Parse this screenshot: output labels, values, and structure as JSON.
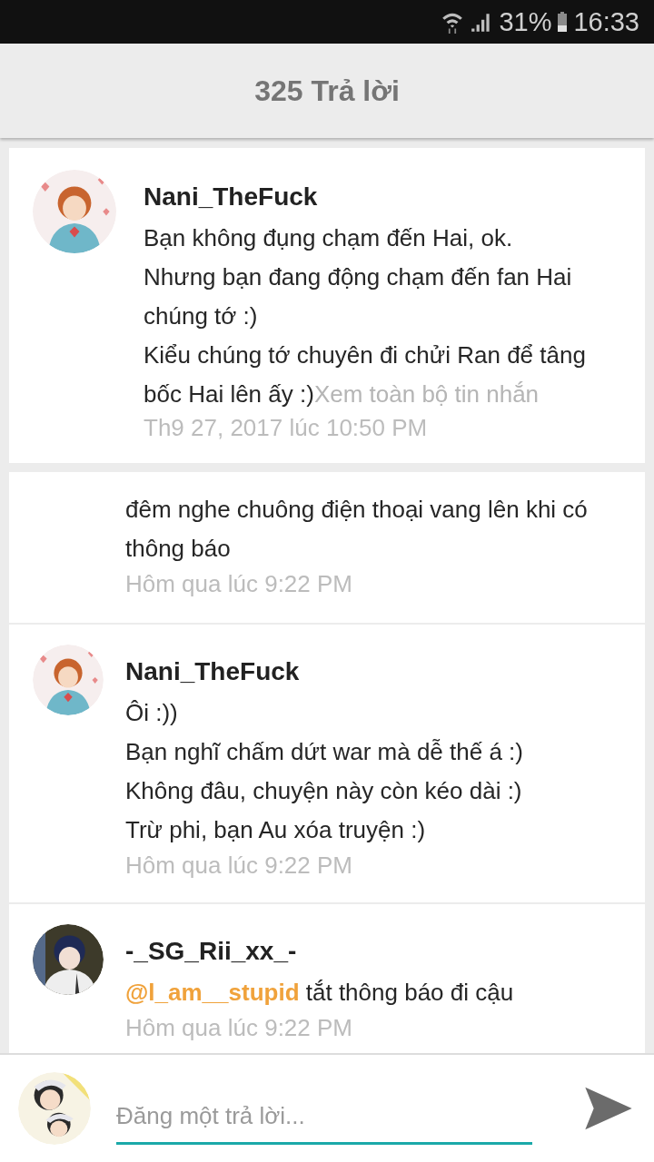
{
  "status_bar": {
    "battery": "31%",
    "time": "16:33"
  },
  "header": {
    "title": "325 Trả lời"
  },
  "pinned_comment": {
    "author": "Nani_TheFuck",
    "message": "Bạn không đụng chạm đến Hai, ok.\nNhưng bạn đang động chạm đến fan Hai chúng tớ :)\nKiểu chúng tớ chuyên đi chửi Ran để tâng bốc Hai lên ấy :)",
    "more_link": "Xem toàn bộ tin nhắn",
    "time": "Th9 27, 2017 lúc 10:50 PM"
  },
  "replies": [
    {
      "kind": "partial",
      "message": "đêm nghe chuông điện thoại vang lên khi có thông báo",
      "time": "Hôm qua lúc 9:22 PM"
    },
    {
      "kind": "full",
      "author": "Nani_TheFuck",
      "message": "Ôi :))\nBạn nghĩ chấm dứt war mà dễ thế á :)\nKhông đâu, chuyện này còn kéo dài :)\nTrừ phi, bạn Au xóa truyện :)",
      "time": "Hôm qua lúc 9:22 PM"
    },
    {
      "kind": "full",
      "author": "-_SG_Rii_xx_-",
      "mention": "@l_am__stupid",
      "message": " tắt thông báo đi cậu",
      "time": "Hôm qua lúc 9:22 PM"
    }
  ],
  "composer": {
    "placeholder": "Đăng một trả lời..."
  }
}
